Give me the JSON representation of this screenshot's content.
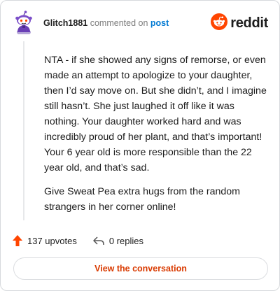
{
  "comment": {
    "author": "Glitch1881",
    "action_text": "commented on",
    "post_link_label": "post",
    "avatar_icon": "snoo-avatar-icon",
    "paragraphs": [
      "NTA - if she showed any signs of remorse, or even made an attempt to apologize to your daughter, then I’d say move on. But she didn’t, and I imagine still hasn’t. She just laughed it off like it was nothing. Your daughter worked hard and was incredibly proud of her plant, and that’s important! Your 6 year old is more responsible than the 22 year old, and that’s sad.",
      "Give Sweat Pea extra hugs from the random strangers in her corner online!"
    ]
  },
  "brand": {
    "name": "reddit",
    "icon": "reddit-logo-icon",
    "color": "#ff4500"
  },
  "stats": {
    "upvotes_label": "137 upvotes",
    "upvote_icon": "upvote-arrow-icon",
    "upvote_color": "#ff4500",
    "replies_label": "0 replies",
    "reply_icon": "reply-arrow-icon"
  },
  "cta": {
    "label": "View the conversation",
    "color": "#d93a00"
  }
}
